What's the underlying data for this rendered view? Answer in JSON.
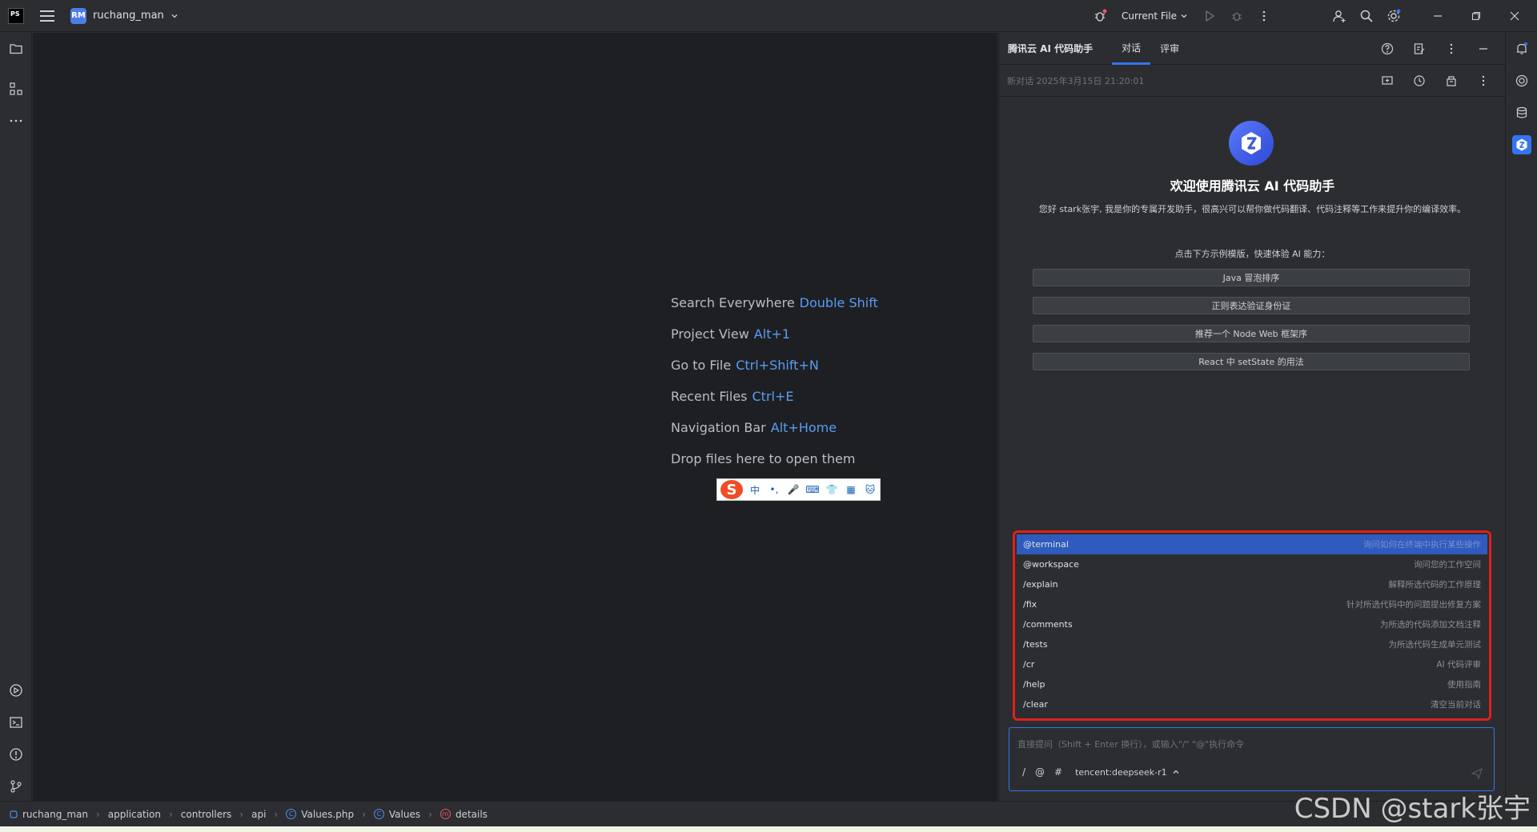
{
  "titlebar": {
    "logo_text": "PS",
    "project_avatar": "RM",
    "project_name": "ruchang_man",
    "run_config": "Current File"
  },
  "editor": {
    "hints": [
      {
        "label": "Search Everywhere",
        "shortcut": "Double Shift"
      },
      {
        "label": "Project View",
        "shortcut": "Alt+1"
      },
      {
        "label": "Go to File",
        "shortcut": "Ctrl+Shift+N"
      },
      {
        "label": "Recent Files",
        "shortcut": "Ctrl+E"
      },
      {
        "label": "Navigation Bar",
        "shortcut": "Alt+Home"
      },
      {
        "label": "Drop files here to open them",
        "shortcut": ""
      }
    ]
  },
  "ime": {
    "logo": "S",
    "items": [
      "中",
      "•,",
      "🎤",
      "⌨",
      "👕",
      "▦",
      "🐱"
    ]
  },
  "ai_panel": {
    "title": "腾讯云 AI 代码助手",
    "tabs": [
      "对话",
      "评审"
    ],
    "session_title": "新对话 2025年3月15日 21:20:01",
    "welcome": "欢迎使用腾讯云 AI 代码助手",
    "description": "您好 stark张宇, 我是你的专属开发助手，很高兴可以帮你做代码翻译、代码注释等工作来提升你的编译效率。",
    "try_hint": "点击下方示例模版，快速体验 AI 能力：",
    "examples": [
      "Java 冒泡排序",
      "正则表达验证身份证",
      "推荐一个 Node Web 框架序",
      "React 中 setState 的用法"
    ],
    "commands": [
      {
        "cmd": "@terminal",
        "desc": "询问如何在终端中执行某些操作"
      },
      {
        "cmd": "@workspace",
        "desc": "询问您的工作空间"
      },
      {
        "cmd": "/explain",
        "desc": "解释所选代码的工作原理"
      },
      {
        "cmd": "/fix",
        "desc": "针对所选代码中的问题提出修复方案"
      },
      {
        "cmd": "/comments",
        "desc": "为所选的代码添加文档注释"
      },
      {
        "cmd": "/tests",
        "desc": "为所选代码生成单元测试"
      },
      {
        "cmd": "/cr",
        "desc": "AI 代码评审"
      },
      {
        "cmd": "/help",
        "desc": "使用指南"
      },
      {
        "cmd": "/clear",
        "desc": "清空当前对话"
      }
    ],
    "input_placeholder": "直接提问（Shift + Enter 换行），或输入\"/\" \"@\"执行命令",
    "input_tools": [
      "/",
      "@",
      "#"
    ],
    "model": "tencent:deepseek-r1"
  },
  "statusbar": {
    "crumbs": [
      "ruchang_man",
      "application",
      "controllers",
      "api",
      "Values.php",
      "Values",
      "details"
    ]
  },
  "watermark": "CSDN @stark张宇",
  "colors": {
    "accent": "#3574f0",
    "highlight_border": "#e0201a",
    "shortcut": "#589df6"
  }
}
